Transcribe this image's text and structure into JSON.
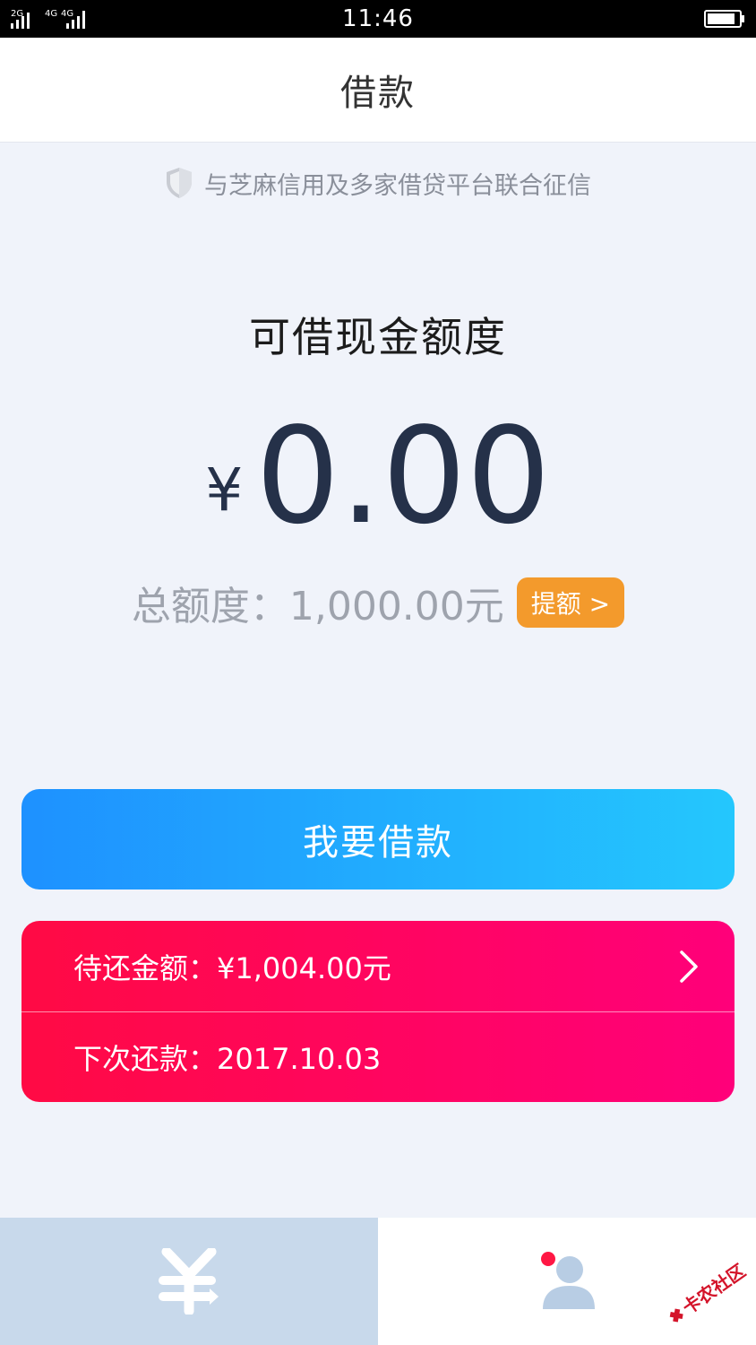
{
  "status_bar": {
    "network_1": "2G",
    "network_2": "4G",
    "network_3": "4G",
    "time": "11:46"
  },
  "header": {
    "title": "借款"
  },
  "notice": {
    "text": "与芝麻信用及多家借贷平台联合征信",
    "icon": "shield-icon"
  },
  "credit": {
    "label": "可借现金额度",
    "currency_symbol": "¥",
    "available_amount": "0.00",
    "total_label": "总额度：",
    "total_value": "1,000.00元",
    "raise_button_label": "提额 >"
  },
  "actions": {
    "borrow_label": "我要借款"
  },
  "repayment": {
    "pending_label": "待还金额：¥1,004.00元",
    "next_label": "下次还款：2017.10.03"
  },
  "tabbar": {
    "tab_loan_icon": "yen-icon",
    "tab_profile_icon": "user-icon"
  },
  "watermark": {
    "text": "卡农社区"
  },
  "colors": {
    "primary_blue_start": "#1e91ff",
    "primary_blue_end": "#24c7fd",
    "repay_red_start": "#ff0a44",
    "repay_red_end": "#ff007a",
    "raise_orange": "#f39a2c",
    "amount_navy": "#253149",
    "page_bg": "#f0f3fa",
    "tab_active_bg": "#c8d9eb"
  }
}
